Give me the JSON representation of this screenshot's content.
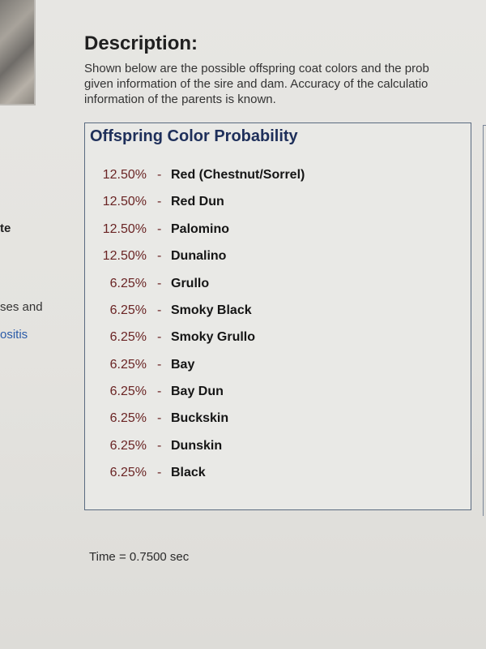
{
  "left_column": {
    "fragments": [
      "te",
      "ses and",
      "ositis"
    ]
  },
  "description": {
    "title": "Description:",
    "lines": [
      "Shown below are the possible offspring coat colors and the prob",
      "given information of the sire and dam. Accuracy of the calculatio",
      "information of the parents is known."
    ]
  },
  "panel": {
    "title": "Offspring Color Probability",
    "separator": "-",
    "rows": [
      {
        "percent": "12.50%",
        "color": "Red (Chestnut/Sorrel)"
      },
      {
        "percent": "12.50%",
        "color": "Red Dun"
      },
      {
        "percent": "12.50%",
        "color": "Palomino"
      },
      {
        "percent": "12.50%",
        "color": "Dunalino"
      },
      {
        "percent": "6.25%",
        "color": "Grullo"
      },
      {
        "percent": "6.25%",
        "color": "Smoky Black"
      },
      {
        "percent": "6.25%",
        "color": "Smoky Grullo"
      },
      {
        "percent": "6.25%",
        "color": "Bay"
      },
      {
        "percent": "6.25%",
        "color": "Bay Dun"
      },
      {
        "percent": "6.25%",
        "color": "Buckskin"
      },
      {
        "percent": "6.25%",
        "color": "Dunskin"
      },
      {
        "percent": "6.25%",
        "color": "Black"
      }
    ]
  },
  "footer": {
    "time": "Time = 0.7500 sec"
  },
  "colors": {
    "panel_title": "#1e2f5a",
    "percent_text": "#6a2424",
    "link": "#2a5ba8",
    "panel_border": "#5a6a80"
  }
}
